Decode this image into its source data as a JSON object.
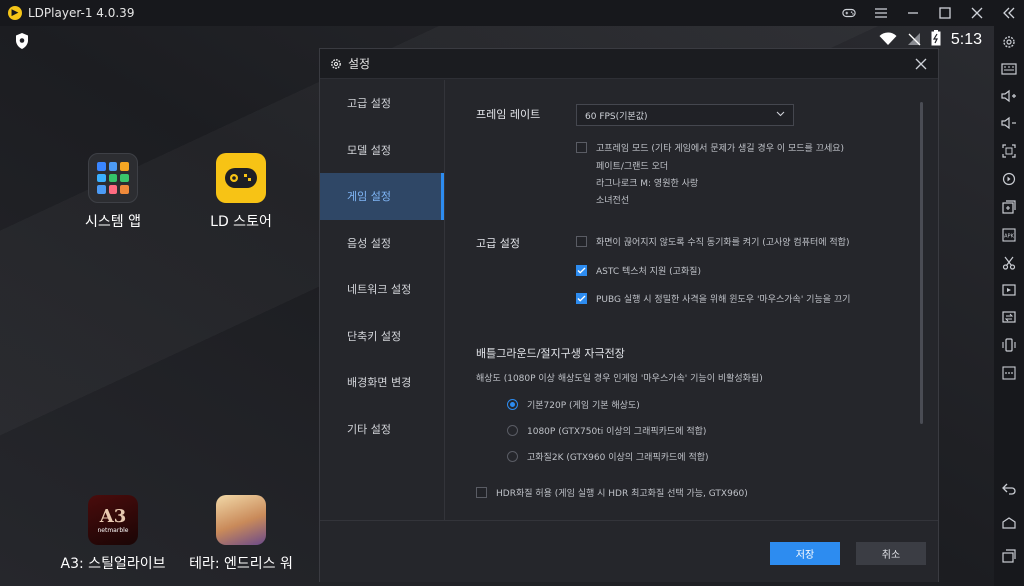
{
  "window": {
    "title": "LDPlayer-1 4.0.39"
  },
  "status": {
    "time": "5:13"
  },
  "desktop": {
    "apps": [
      {
        "label": "시스템 앱"
      },
      {
        "label": "LD 스토어"
      },
      {
        "label": "A3: 스틸얼라이브",
        "badge": "netmarble"
      },
      {
        "label": "테라: 엔드리스 워"
      }
    ]
  },
  "dialog": {
    "title": "설정",
    "nav": [
      "고급 설정",
      "모델 설정",
      "게임 설정",
      "음성 설정",
      "네트워크 설정",
      "단축키 설정",
      "배경화면 변경",
      "기타 설정"
    ],
    "active_nav": "게임 설정",
    "frame_rate": {
      "label": "프레임 레이트",
      "selected": "60 FPS(기본값)",
      "high_frame_mode": {
        "label": "고프레임 모드  (기타 게임에서 문제가 생길 경우 이 모드를 끄세요)",
        "checked": false,
        "games": [
          "페이트/그랜드 오더",
          "라그나로크 M: 영원한 사랑",
          "소녀전선"
        ]
      }
    },
    "advanced": {
      "label": "고급 설정",
      "options": [
        {
          "label": "화면이 끊어지지 않도록 수직 동기화를 켜기  (고사양 컴퓨터에 적합)",
          "checked": false
        },
        {
          "label": "ASTC 텍스처 지원 (고화질)",
          "checked": true
        },
        {
          "label": "PUBG 실행 시 정밀한 사격을 위해 윈도우 '마우스가속' 기능을 끄기",
          "checked": true
        }
      ]
    },
    "battleground": {
      "label": "배틀그라운드/절지구생 자극전장",
      "desc": "해상도 (1080P 이상 해상도일 경우 인게임  '마우스가속' 기능이 비활성화됨)",
      "options": [
        {
          "label": "기본720P (게임 기본 해상도)",
          "selected": true
        },
        {
          "label": "1080P (GTX750ti 이상의 그래픽카드에 적합)",
          "selected": false
        },
        {
          "label": "고화질2K (GTX960 이상의 그래픽카드에 적합)",
          "selected": false
        }
      ],
      "hdr": {
        "label": "HDR화질 허용 (게임 실행 시 HDR 최고화질 선택 가능, GTX960)",
        "checked": false
      }
    },
    "buttons": {
      "save": "저장",
      "cancel": "취소"
    }
  },
  "colors": {
    "accent": "#2d8cf0",
    "active_nav_bg": "#2f4766"
  }
}
